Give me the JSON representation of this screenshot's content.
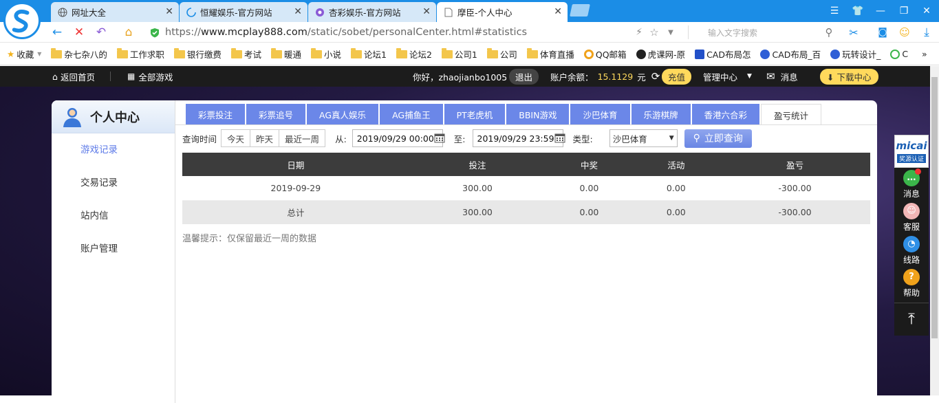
{
  "browser": {
    "tabs": [
      {
        "title": "网址大全",
        "icon": "globe-icon"
      },
      {
        "title": "恒耀娱乐-官方网站",
        "icon": "loading-icon"
      },
      {
        "title": "杏彩娱乐-官方网站",
        "icon": "site-icon"
      },
      {
        "title": "摩臣-个人中心",
        "icon": "page-icon"
      }
    ],
    "url_scheme": "https://",
    "url_host": "www.mcplay888.com",
    "url_path": "/static/sobet/personalCenter.html#statistics",
    "search_placeholder": "输入文字搜索",
    "bookmarks": [
      "收藏",
      "杂七杂八的",
      "工作求职",
      "银行缴费",
      "考试",
      "暖通",
      "小说",
      "论坛1",
      "论坛2",
      "公司1",
      "公司",
      "体育直播",
      "QQ邮箱",
      "虎课网-原",
      "CAD布局怎",
      "CAD布局_百",
      "玩转设计_",
      "C"
    ]
  },
  "header": {
    "home": "返回首页",
    "all_games": "全部游戏",
    "greeting": "你好，zhaojianbo1005",
    "logout": "退出",
    "balance_label": "账户余额：",
    "balance_value": "15.1129",
    "balance_unit": "元",
    "recharge": "充值",
    "manage": "管理中心",
    "messages": "消息",
    "download": "下载中心"
  },
  "sidebar": {
    "title": "个人中心",
    "items": [
      "游戏记录",
      "交易记录",
      "站内信",
      "账户管理"
    ]
  },
  "game_tabs": [
    "彩票投注",
    "彩票追号",
    "AG真人娱乐",
    "AG捕鱼王",
    "PT老虎机",
    "BBIN游戏",
    "沙巴体育",
    "乐游棋牌",
    "香港六合彩",
    "盈亏统计"
  ],
  "filter": {
    "label": "查询时间",
    "quick": [
      "今天",
      "昨天",
      "最近一周"
    ],
    "from_label": "从:",
    "from_value": "2019/09/29 00:00",
    "to_label": "至:",
    "to_value": "2019/09/29 23:59",
    "type_label": "类型:",
    "type_value": "沙巴体育",
    "query_button": "立即查询"
  },
  "table": {
    "columns": [
      "日期",
      "投注",
      "中奖",
      "活动",
      "盈亏"
    ],
    "rows": [
      [
        "2019-09-29",
        "300.00",
        "0.00",
        "0.00",
        "-300.00"
      ],
      [
        "总计",
        "300.00",
        "0.00",
        "0.00",
        "-300.00"
      ]
    ]
  },
  "tip": "温馨提示：仅保留最近一周的数据",
  "float_bar": {
    "logo": "micai",
    "logo_sub": "奖源认证",
    "items": [
      "消息",
      "客服",
      "线路",
      "帮助"
    ]
  }
}
